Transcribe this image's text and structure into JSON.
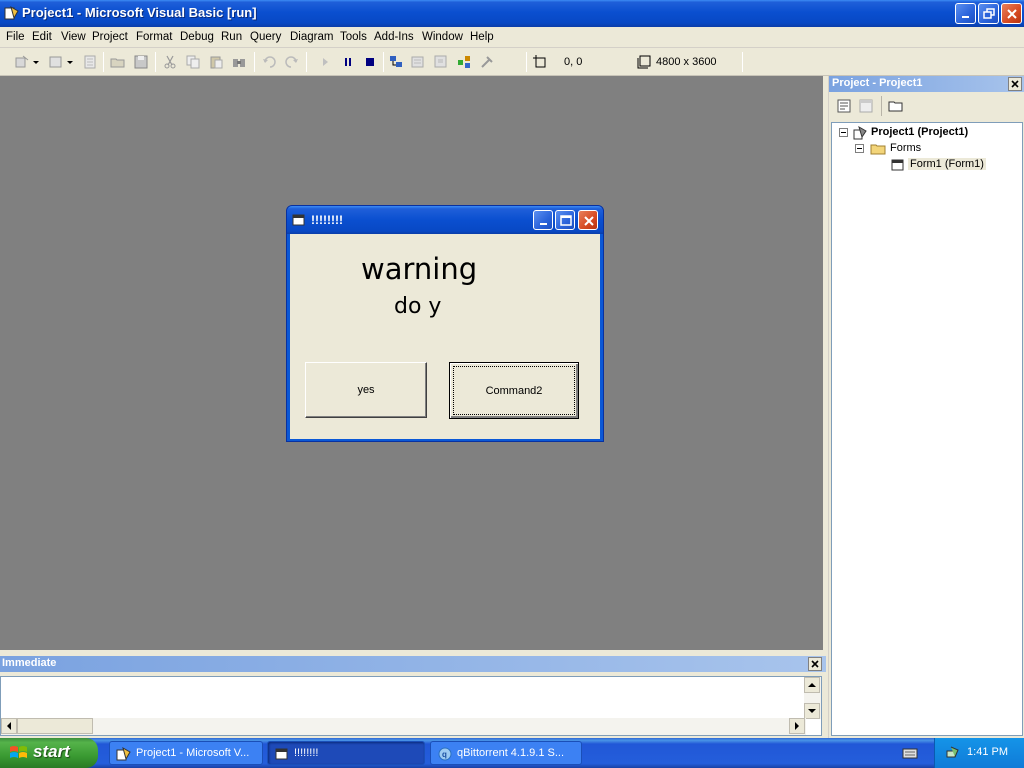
{
  "window": {
    "title": "Project1 - Microsoft Visual Basic [run]"
  },
  "menu": [
    "File",
    "Edit",
    "View",
    "Project",
    "Format",
    "Debug",
    "Run",
    "Query",
    "Diagram",
    "Tools",
    "Add-Ins",
    "Window",
    "Help"
  ],
  "toolbar": {
    "position_readout": "0, 0",
    "size_readout": "4800 x 3600"
  },
  "form": {
    "caption": "!!!!!!!!",
    "label1": "warning",
    "label2": "do y",
    "button_yes": "yes",
    "button_command2": "Command2"
  },
  "project_explorer": {
    "title": "Project - Project1",
    "root": "Project1 (Project1)",
    "folder": "Forms",
    "item": "Form1 (Form1)"
  },
  "immediate": {
    "title": "Immediate"
  },
  "taskbar": {
    "start": "start",
    "tasks": [
      "Project1 - Microsoft V...",
      "!!!!!!!!",
      "qBittorrent 4.1.9.1 S..."
    ],
    "clock": "1:41 PM"
  }
}
